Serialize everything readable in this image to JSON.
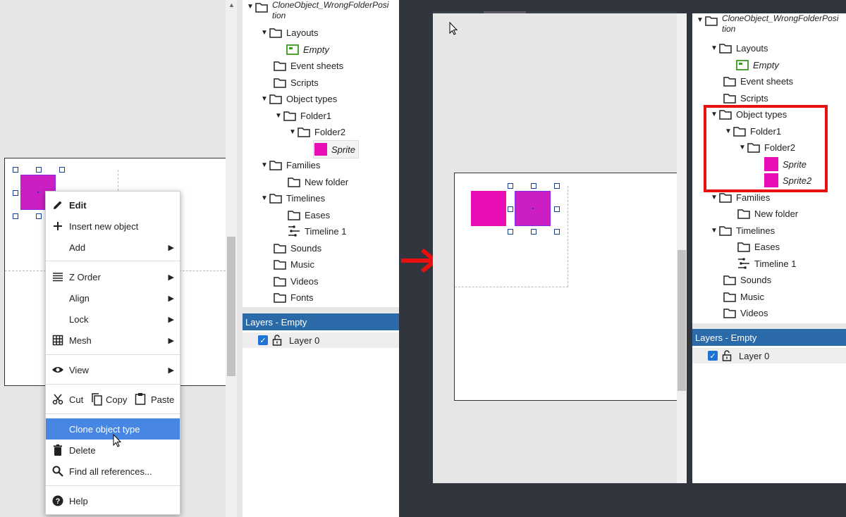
{
  "colors": {
    "sprite": "#e80db4",
    "selected": "#4786e2",
    "layers_header": "#2a6aa8",
    "highlight_box": "#ea1010",
    "arrow": "#ea1010",
    "dark_bg": "#31353d"
  },
  "context_menu": {
    "items": [
      {
        "label": "Edit",
        "icon": "pencil-icon"
      },
      {
        "label": "Insert new object",
        "icon": "plus-icon"
      },
      {
        "label": "Add",
        "icon": ""
      },
      {
        "label": "Z Order",
        "icon": "lines-icon"
      },
      {
        "label": "Align",
        "icon": ""
      },
      {
        "label": "Lock",
        "icon": ""
      },
      {
        "label": "Mesh",
        "icon": "grid-icon"
      },
      {
        "label": "View",
        "icon": "eye-icon"
      },
      {
        "label": "Cut",
        "icon": "scissors-icon"
      },
      {
        "label": "Copy",
        "icon": "copy-icon"
      },
      {
        "label": "Paste",
        "icon": "paste-icon"
      },
      {
        "label": "Clone object type",
        "icon": ""
      },
      {
        "label": "Delete",
        "icon": "trash-icon"
      },
      {
        "label": "Find all references...",
        "icon": "search-icon"
      },
      {
        "label": "Help",
        "icon": "help-icon"
      }
    ],
    "highlighted": "Clone object type"
  },
  "project_before": {
    "root": "CloneObject_WrongFolderPosition",
    "root_line1": "CloneObject_WrongFolderPosi",
    "root_line2": "tion",
    "items": {
      "layouts": "Layouts",
      "empty": "Empty",
      "event_sheets": "Event sheets",
      "scripts": "Scripts",
      "object_types": "Object types",
      "folder1": "Folder1",
      "folder2": "Folder2",
      "sprite": "Sprite",
      "families": "Families",
      "new_folder": "New folder",
      "timelines": "Timelines",
      "eases": "Eases",
      "timeline1": "Timeline 1",
      "sounds": "Sounds",
      "music": "Music",
      "videos": "Videos",
      "fonts": "Fonts"
    }
  },
  "layers_before": {
    "title": "Layers - Empty",
    "layer": "Layer 0"
  },
  "project_after": {
    "root_line1": "CloneObject_WrongFolderPosi",
    "root_line2": "tion",
    "items": {
      "layouts": "Layouts",
      "empty": "Empty",
      "event_sheets": "Event sheets",
      "scripts": "Scripts",
      "object_types": "Object types",
      "folder1": "Folder1",
      "folder2": "Folder2",
      "sprite": "Sprite",
      "sprite2": "Sprite2",
      "families": "Families",
      "new_folder": "New folder",
      "timelines": "Timelines",
      "eases": "Eases",
      "timeline1": "Timeline 1",
      "sounds": "Sounds",
      "music": "Music",
      "videos": "Videos"
    }
  },
  "layers_after": {
    "title": "Layers - Empty",
    "layer": "Layer 0"
  }
}
